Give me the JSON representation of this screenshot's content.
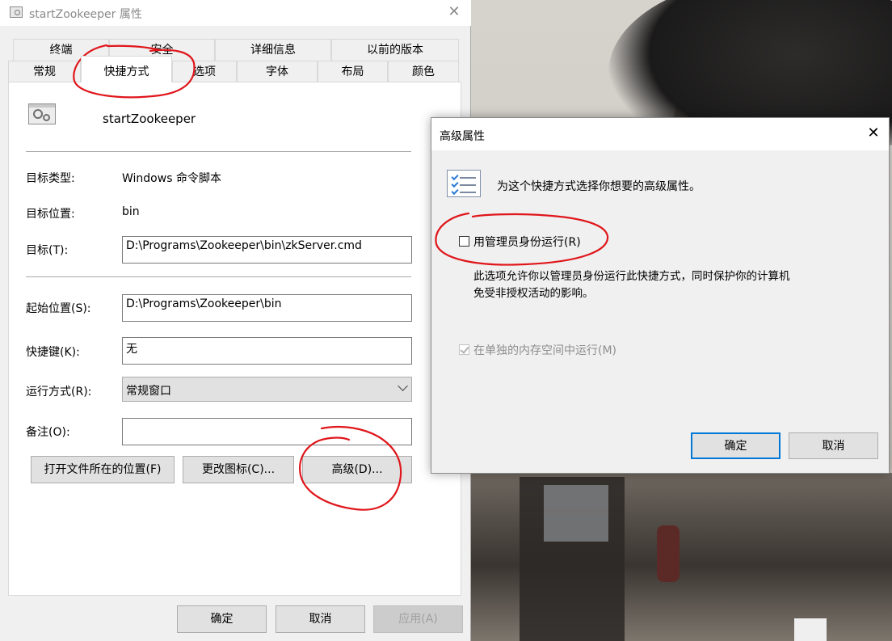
{
  "window": {
    "title": "startZookeeper 属性",
    "tabs_row1": [
      "终端",
      "安全",
      "详细信息",
      "以前的版本"
    ],
    "tabs_row2": [
      "常规",
      "快捷方式",
      "选项",
      "字体",
      "布局",
      "颜色"
    ],
    "active_tab": "快捷方式",
    "app_name": "startZookeeper",
    "target_type_label": "目标类型:",
    "target_type_value": "Windows 命令脚本",
    "target_location_label": "目标位置:",
    "target_location_value": "bin",
    "target_label": "目标(T):",
    "target_value": "D:\\Programs\\Zookeeper\\bin\\zkServer.cmd",
    "start_in_label": "起始位置(S):",
    "start_in_value": "D:\\Programs\\Zookeeper\\bin",
    "shortcut_key_label": "快捷键(K):",
    "shortcut_key_value": "无",
    "run_label": "运行方式(R):",
    "run_value": "常规窗口",
    "comment_label": "备注(O):",
    "comment_value": "",
    "open_location_button": "打开文件所在的位置(F)",
    "change_icon_button": "更改图标(C)...",
    "advanced_button": "高级(D)...",
    "ok_button": "确定",
    "cancel_button": "取消",
    "apply_button": "应用(A)"
  },
  "dialog": {
    "title": "高级属性",
    "intro": "为这个快捷方式选择你想要的高级属性。",
    "run_as_admin_label": "用管理员身份运行(R)",
    "run_as_admin_checked": false,
    "description_line1": "此选项允许你以管理员身份运行此快捷方式，同时保护你的计算机",
    "description_line2": "免受非授权活动的影响。",
    "separate_memory_label": "在单独的内存空间中运行(M)",
    "separate_memory_checked": true,
    "ok_button": "确定",
    "cancel_button": "取消"
  },
  "colors": {
    "accent": "#0078d7",
    "annotation": "#e0161b"
  }
}
